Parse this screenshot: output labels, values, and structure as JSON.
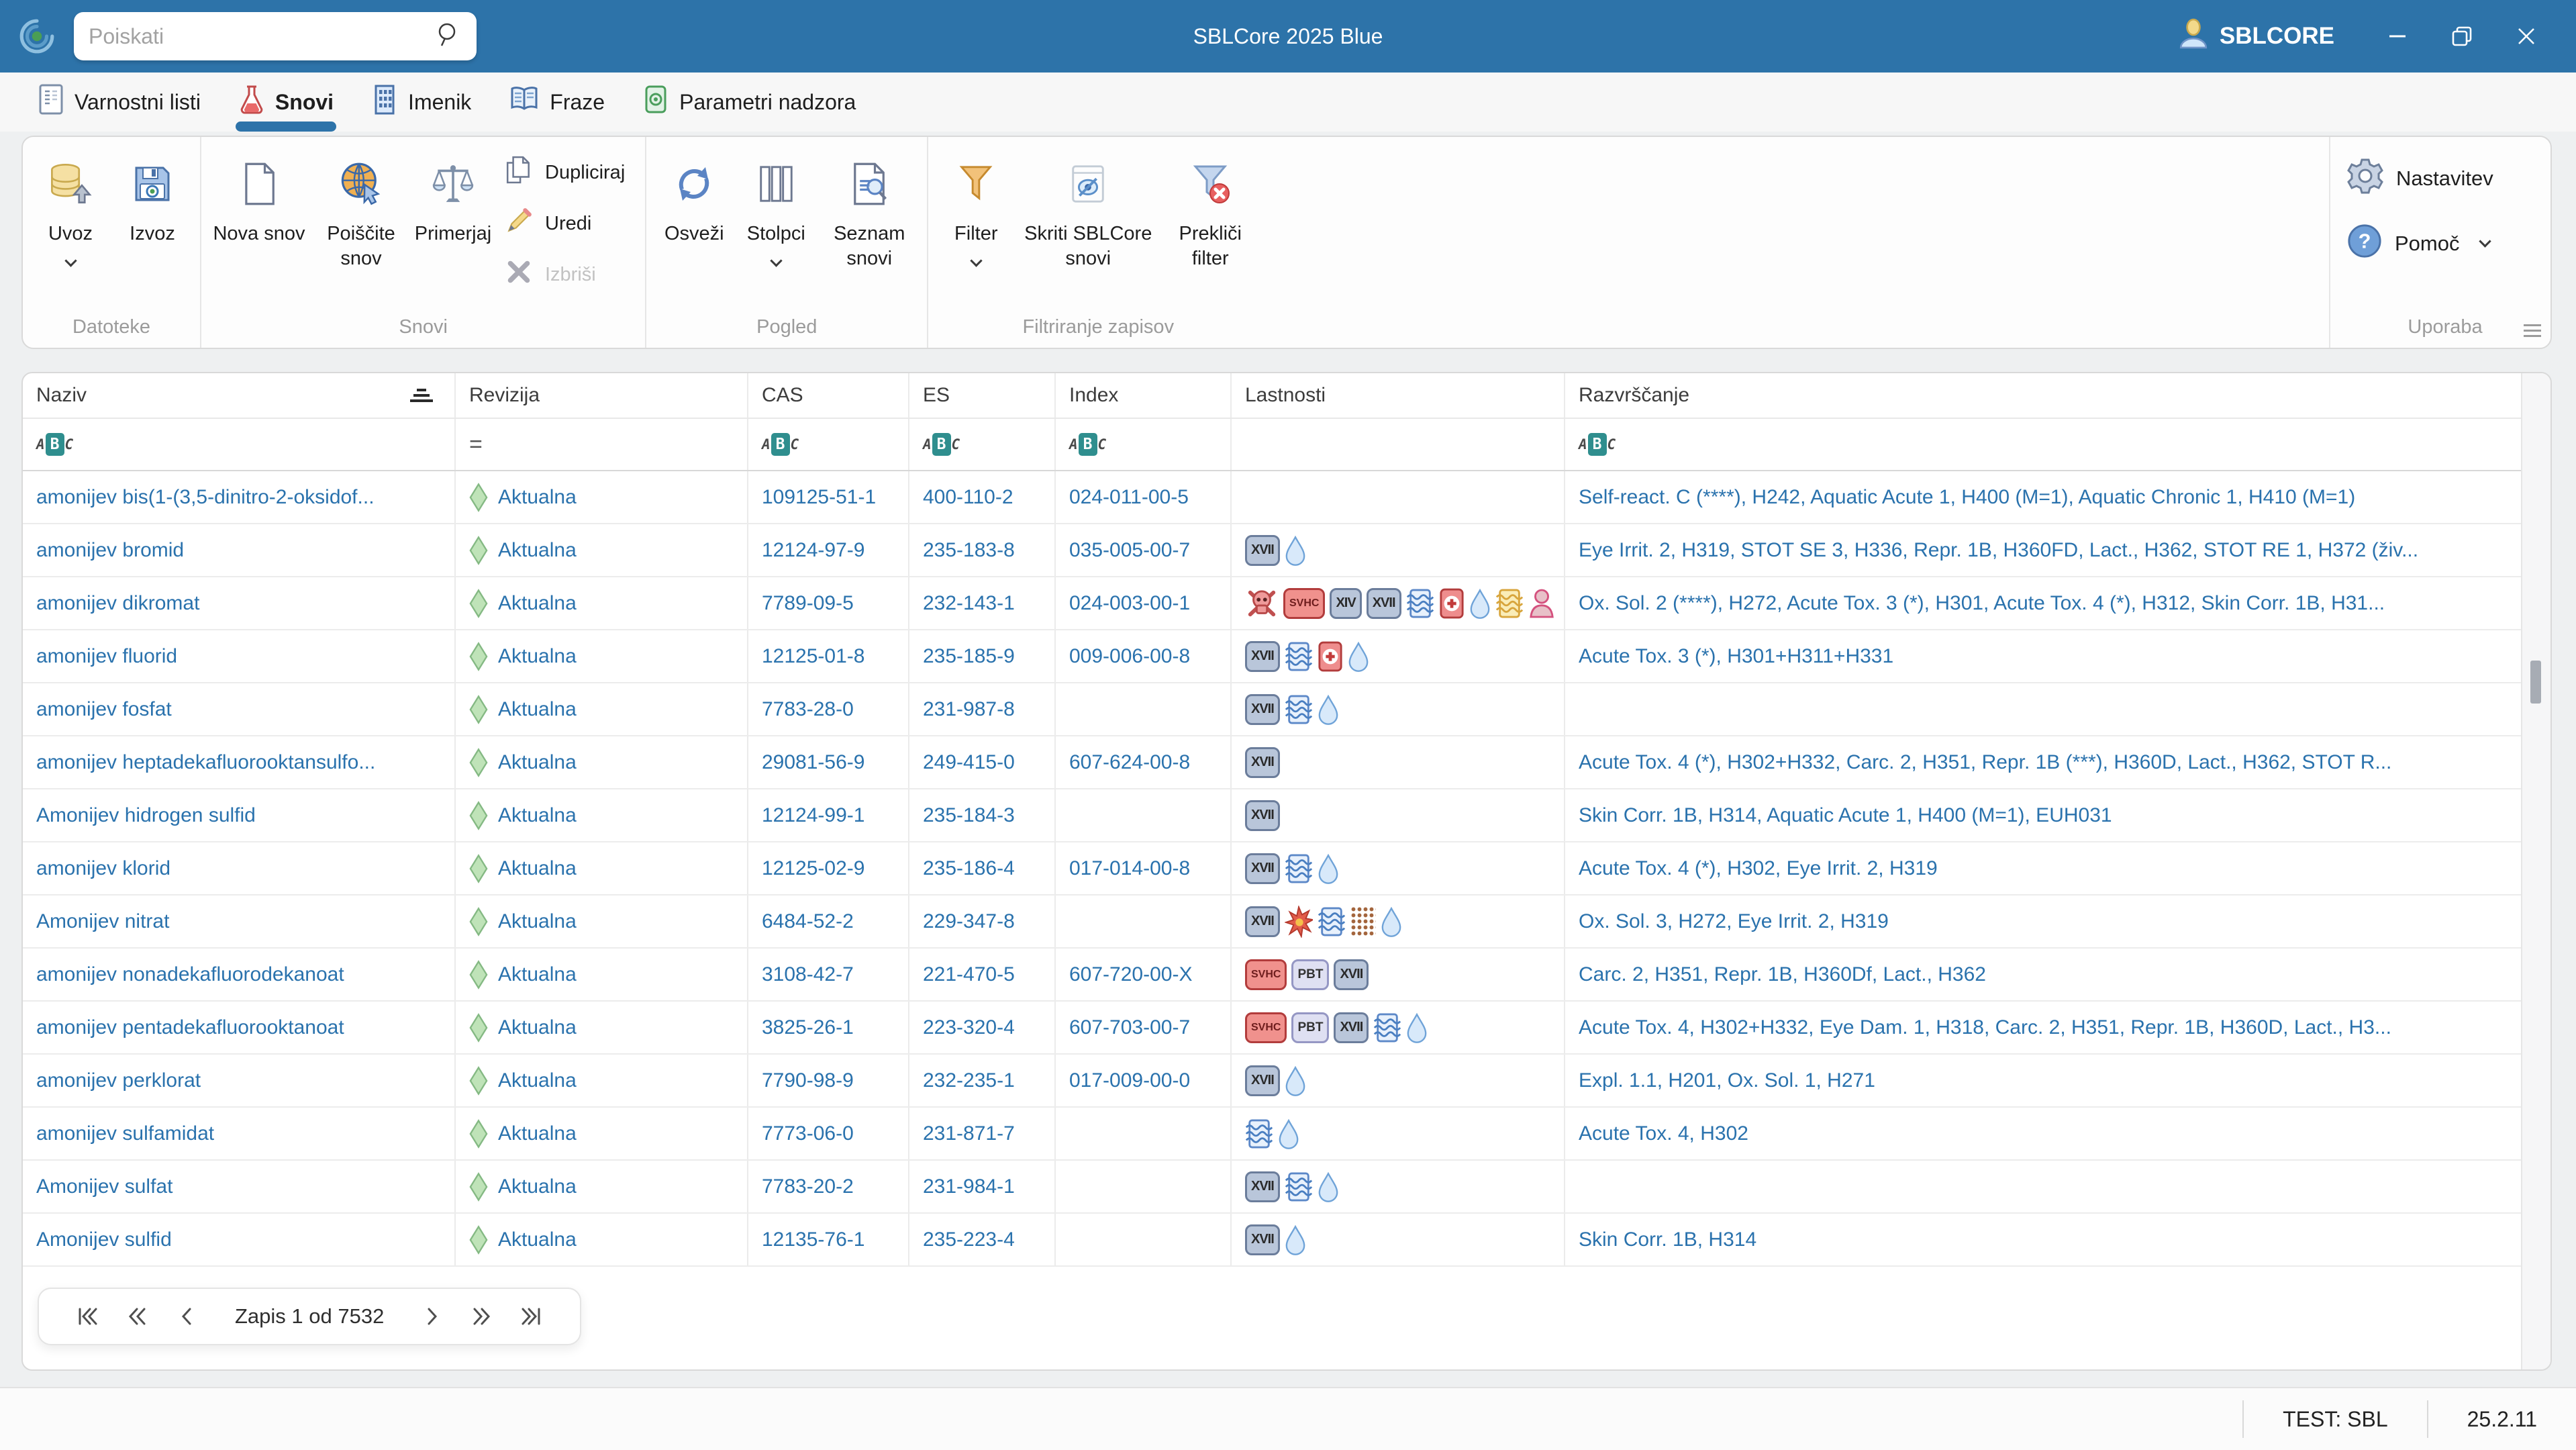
{
  "titlebar": {
    "search_placeholder": "Poiskati",
    "title": "SBLCore 2025 Blue",
    "user": "SBLCORE"
  },
  "tabs": [
    {
      "label": "Varnostni listi"
    },
    {
      "label": "Snovi"
    },
    {
      "label": "Imenik"
    },
    {
      "label": "Fraze"
    },
    {
      "label": "Parametri nadzora"
    }
  ],
  "ribbon": {
    "uvoz": "Uvoz",
    "izvoz": "Izvoz",
    "datoteke": "Datoteke",
    "nova_snov": "Nova snov",
    "poiscite_snov": "Poiščite snov",
    "primerjaj": "Primerjaj",
    "dupliciraj": "Dupliciraj",
    "uredi": "Uredi",
    "izbrisi": "Izbriši",
    "snovi": "Snovi",
    "osvezi": "Osveži",
    "stolpci": "Stolpci",
    "seznam_snovi": "Seznam snovi",
    "pogled": "Pogled",
    "filter": "Filter",
    "skriti": "Skriti SBLCore snovi",
    "preklici": "Prekliči filter",
    "filtriranje": "Filtriranje zapisov",
    "nastavitev": "Nastavitev",
    "pomoc": "Pomoč",
    "uporaba": "Uporaba"
  },
  "icons": {
    "badge_labels": {
      "xvii": "XVII",
      "xiv": "XIV",
      "svhc": "SVHC",
      "pbt": "PBT"
    },
    "abc_letters": [
      "A",
      "B",
      "C"
    ],
    "eq": "="
  },
  "colors": {
    "titlebar": "#2d73a9",
    "accent": "#2d73a9",
    "link_text": "#2a72ad",
    "filter_teal": "#2f8e8e",
    "revision_green": "#bfe3b8"
  },
  "table": {
    "columns": [
      {
        "label": "Naziv",
        "filter": "abc",
        "sort": true
      },
      {
        "label": "Revizija",
        "filter": "eq",
        "sort": false
      },
      {
        "label": "CAS",
        "filter": "abc",
        "sort": false
      },
      {
        "label": "ES",
        "filter": "abc",
        "sort": false
      },
      {
        "label": "Index",
        "filter": "abc",
        "sort": false
      },
      {
        "label": "Lastnosti",
        "filter": "none",
        "sort": false
      },
      {
        "label": "Razvrščanje",
        "filter": "abc",
        "sort": false
      }
    ],
    "rows": [
      {
        "name": "amonijev bis(1-(3,5-dinitro-2-oksidof...",
        "revision": "Aktualna",
        "cas": "109125-51-1",
        "es": "400-110-2",
        "index": "024-011-00-5",
        "props": [],
        "classification": "Self-react. C (****), H242, Aquatic Acute 1, H400 (M=1), Aquatic Chronic 1, H410 (M=1)"
      },
      {
        "name": "amonijev bromid",
        "revision": "Aktualna",
        "cas": "12124-97-9",
        "es": "235-183-8",
        "index": "035-005-00-7",
        "props": [
          "xvii",
          "drop"
        ],
        "classification": "Eye Irrit. 2, H319, STOT SE 3, H336, Repr. 1B, H360FD, Lact., H362, STOT RE 1, H372 (živ..."
      },
      {
        "name": "amonijev dikromat",
        "revision": "Aktualna",
        "cas": "7789-09-5",
        "es": "232-143-1",
        "index": "024-003-00-1",
        "props": [
          "skull",
          "svhc",
          "xiv",
          "xvii",
          "waves",
          "plus",
          "drop",
          "waves_yellow",
          "person"
        ],
        "classification": "Ox. Sol. 2 (****), H272, Acute Tox. 3 (*), H301, Acute Tox. 4 (*), H312, Skin Corr. 1B, H31..."
      },
      {
        "name": "amonijev fluorid",
        "revision": "Aktualna",
        "cas": "12125-01-8",
        "es": "235-185-9",
        "index": "009-006-00-8",
        "props": [
          "xvii",
          "waves",
          "plus",
          "drop"
        ],
        "classification": "Acute Tox. 3 (*), H301+H311+H331"
      },
      {
        "name": "amonijev fosfat",
        "revision": "Aktualna",
        "cas": "7783-28-0",
        "es": "231-987-8",
        "index": "",
        "props": [
          "xvii",
          "waves",
          "drop"
        ],
        "classification": ""
      },
      {
        "name": "amonijev heptadekafluorooktansulfo...",
        "revision": "Aktualna",
        "cas": "29081-56-9",
        "es": "249-415-0",
        "index": "607-624-00-8",
        "props": [
          "xvii"
        ],
        "classification": "Acute Tox. 4 (*), H302+H332, Carc. 2, H351, Repr. 1B (***), H360D, Lact., H362, STOT R..."
      },
      {
        "name": "Amonijev hidrogen sulfid",
        "revision": "Aktualna",
        "cas": "12124-99-1",
        "es": "235-184-3",
        "index": "",
        "props": [
          "xvii"
        ],
        "classification": "Skin Corr. 1B, H314, Aquatic Acute 1, H400 (M=1), EUH031"
      },
      {
        "name": "amonijev klorid",
        "revision": "Aktualna",
        "cas": "12125-02-9",
        "es": "235-186-4",
        "index": "017-014-00-8",
        "props": [
          "xvii",
          "waves",
          "drop"
        ],
        "classification": "Acute Tox. 4 (*), H302, Eye Irrit. 2, H319"
      },
      {
        "name": "Amonijev nitrat",
        "revision": "Aktualna",
        "cas": "6484-52-2",
        "es": "229-347-8",
        "index": "",
        "props": [
          "xvii",
          "explosion",
          "waves",
          "dots",
          "drop"
        ],
        "classification": "Ox. Sol. 3, H272, Eye Irrit. 2, H319"
      },
      {
        "name": "amonijev nonadekafluorodekanoat",
        "revision": "Aktualna",
        "cas": "3108-42-7",
        "es": "221-470-5",
        "index": "607-720-00-X",
        "props": [
          "svhc",
          "pbt",
          "xvii"
        ],
        "classification": "Carc. 2, H351, Repr. 1B, H360Df, Lact., H362"
      },
      {
        "name": "amonijev pentadekafluorooktanoat",
        "revision": "Aktualna",
        "cas": "3825-26-1",
        "es": "223-320-4",
        "index": "607-703-00-7",
        "props": [
          "svhc",
          "pbt",
          "xvii",
          "waves",
          "drop"
        ],
        "classification": "Acute Tox. 4, H302+H332, Eye Dam. 1, H318, Carc. 2, H351, Repr. 1B, H360D, Lact., H3..."
      },
      {
        "name": "amonijev perklorat",
        "revision": "Aktualna",
        "cas": "7790-98-9",
        "es": "232-235-1",
        "index": "017-009-00-0",
        "props": [
          "xvii",
          "drop"
        ],
        "classification": "Expl. 1.1, H201, Ox. Sol. 1, H271"
      },
      {
        "name": "amonijev sulfamidat",
        "revision": "Aktualna",
        "cas": "7773-06-0",
        "es": "231-871-7",
        "index": "",
        "props": [
          "waves",
          "drop"
        ],
        "classification": "Acute Tox. 4, H302"
      },
      {
        "name": "Amonijev sulfat",
        "revision": "Aktualna",
        "cas": "7783-20-2",
        "es": "231-984-1",
        "index": "",
        "props": [
          "xvii",
          "waves",
          "drop"
        ],
        "classification": ""
      },
      {
        "name": "Amonijev sulfid",
        "revision": "Aktualna",
        "cas": "12135-76-1",
        "es": "235-223-4",
        "index": "",
        "props": [
          "xvii",
          "drop"
        ],
        "classification": "Skin Corr. 1B, H314"
      }
    ]
  },
  "pager": {
    "record_label": "Zapis 1 od 7532"
  },
  "statusbar": {
    "items": [
      "TEST: SBL",
      "25.2.11"
    ]
  }
}
